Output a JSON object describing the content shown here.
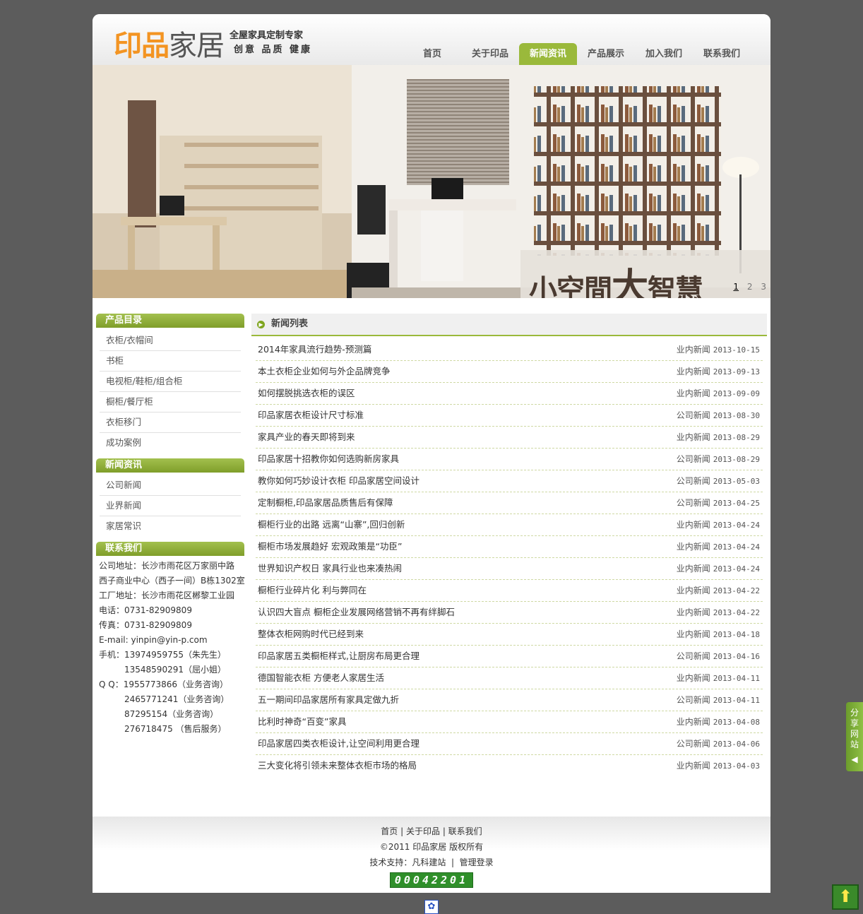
{
  "header": {
    "logo_main_a": "印品",
    "logo_main_b": "家居",
    "logo_sub_1": "全屋家具定制专家",
    "logo_sub_2": "创意 品质 健康"
  },
  "nav": [
    {
      "label": "首页"
    },
    {
      "label": "关于印品"
    },
    {
      "label": "新闻资讯"
    },
    {
      "label": "产品展示"
    },
    {
      "label": "加入我们"
    },
    {
      "label": "联系我们"
    }
  ],
  "nav_active_index": 2,
  "banner": {
    "slogan_a": "小空間",
    "slogan_b": "大",
    "slogan_c": "智慧",
    "pages": [
      "1",
      "2",
      "3"
    ],
    "active_page": 0
  },
  "sidebar": {
    "products_title": "产品目录",
    "products": [
      "衣柜/衣帽间",
      "书柜",
      "电视柜/鞋柜/组合柜",
      "橱柜/餐厅柜",
      "衣柜移门",
      "成功案例"
    ],
    "news_title": "新闻资讯",
    "news": [
      "公司新闻",
      "业界新闻",
      "家居常识"
    ],
    "contact_title": "联系我们",
    "contact": [
      "公司地址：长沙市雨花区万家丽中路",
      "西子商业中心（西子一间）B栋1302室",
      "工厂地址：长沙市雨花区郴黎工业园",
      "电话：0731-82909809",
      "传真：0731-82909809",
      "E-mail: yinpin@yin-p.com",
      "手机：13974959755（朱先生）",
      "13548590291（屈小姐）",
      "Q  Q：1955773866（业务咨询）",
      "2465771241（业务咨询）",
      "87295154（业务咨询）",
      "276718475 （售后服务）"
    ]
  },
  "main": {
    "title": "新闻列表",
    "items": [
      {
        "title": "2014年家具流行趋势-预测篇",
        "category": "业内新闻",
        "date": "2013-10-15"
      },
      {
        "title": "本土衣柜企业如何与外企品牌竞争",
        "category": "业内新闻",
        "date": "2013-09-13"
      },
      {
        "title": "如何摆脱挑选衣柜的误区",
        "category": "业内新闻",
        "date": "2013-09-09"
      },
      {
        "title": "印品家居衣柜设计尺寸标准",
        "category": "公司新闻",
        "date": "2013-08-30"
      },
      {
        "title": "家具产业的春天即将到来",
        "category": "业内新闻",
        "date": "2013-08-29"
      },
      {
        "title": "印品家居十招教你如何选购新房家具",
        "category": "公司新闻",
        "date": "2013-08-29"
      },
      {
        "title": "教你如何巧妙设计衣柜 印品家居空间设计",
        "category": "公司新闻",
        "date": "2013-05-03"
      },
      {
        "title": "定制橱柜,印品家居品质售后有保障",
        "category": "公司新闻",
        "date": "2013-04-25"
      },
      {
        "title": "橱柜行业的出路 远离“山寨”,回归创新",
        "category": "业内新闻",
        "date": "2013-04-24"
      },
      {
        "title": "橱柜市场发展趋好 宏观政策是“功臣”",
        "category": "业内新闻",
        "date": "2013-04-24"
      },
      {
        "title": "世界知识产权日 家具行业也来凑热闹",
        "category": "业内新闻",
        "date": "2013-04-24"
      },
      {
        "title": "橱柜行业碎片化 利与弊同在",
        "category": "业内新闻",
        "date": "2013-04-22"
      },
      {
        "title": "认识四大盲点 橱柜企业发展网络营销不再有绊脚石",
        "category": "业内新闻",
        "date": "2013-04-22"
      },
      {
        "title": "整体衣柜网购时代已经到来",
        "category": "业内新闻",
        "date": "2013-04-18"
      },
      {
        "title": "印品家居五类橱柜样式,让厨房布局更合理",
        "category": "公司新闻",
        "date": "2013-04-16"
      },
      {
        "title": "德国智能衣柜 方便老人家居生活",
        "category": "业内新闻",
        "date": "2013-04-11"
      },
      {
        "title": "五一期间印品家居所有家具定做九折",
        "category": "公司新闻",
        "date": "2013-04-11"
      },
      {
        "title": "比利时神奇“百变”家具",
        "category": "业内新闻",
        "date": "2013-04-08"
      },
      {
        "title": "印品家居四类衣柜设计,让空间利用更合理",
        "category": "公司新闻",
        "date": "2013-04-06"
      },
      {
        "title": "三大变化将引领未来整体衣柜市场的格局",
        "category": "业内新闻",
        "date": "2013-04-03"
      }
    ]
  },
  "footer": {
    "link_home": "首页",
    "link_about": "关于印品",
    "link_contact": "联系我们",
    "copyright": "©2011 印品家居 版权所有",
    "support_label": "技术支持：",
    "support_link": "凡科建站",
    "admin_link": "管理登录",
    "counter": "00042201"
  },
  "share": {
    "label": "分享网站"
  },
  "colors": {
    "accent": "#9ab93b",
    "logo_orange": "#f39422"
  }
}
